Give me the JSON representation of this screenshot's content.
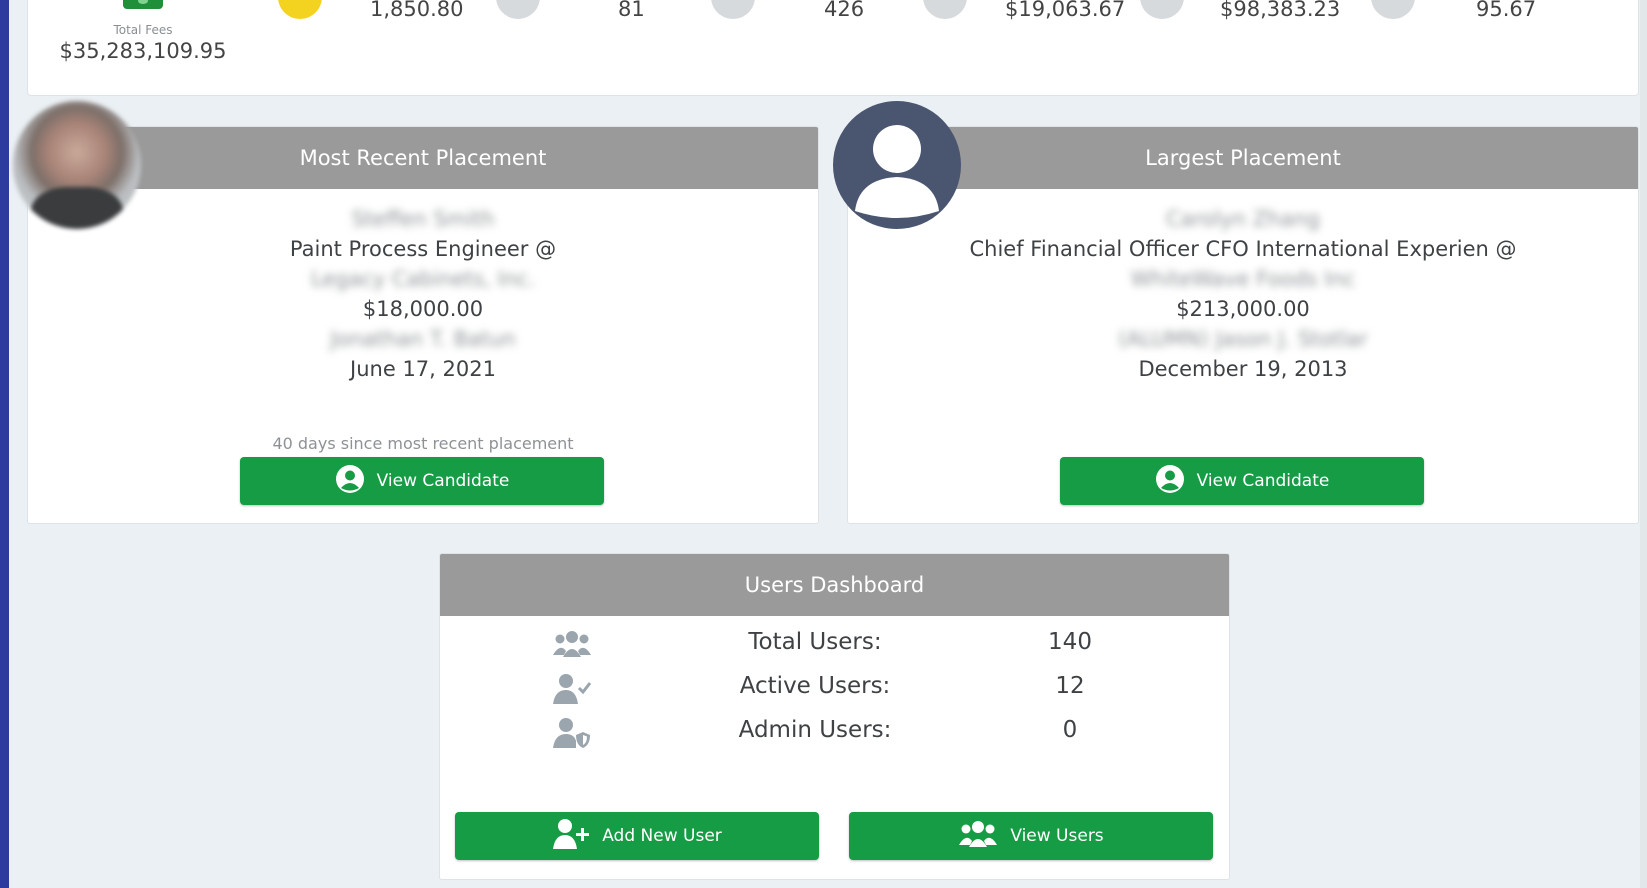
{
  "stats": {
    "total_fees_label": "Total Fees",
    "total_fees_value": "$35,283,109.95",
    "values": [
      "1,850.80",
      "81",
      "426",
      "$19,063.67",
      "$98,383.23",
      "95.67"
    ]
  },
  "recent": {
    "title": "Most Recent Placement",
    "candidate_name": "Steffen Smith",
    "job_title": "Paint Process Engineer @",
    "company": "Legacy Cabinets, Inc.",
    "amount": "$18,000.00",
    "recruiter": "Jonathan T. Batun",
    "date": "June 17, 2021",
    "since_text": "40 days since most recent placement",
    "button_label": "View Candidate"
  },
  "largest": {
    "title": "Largest Placement",
    "candidate_name": "Carolyn Zhang",
    "job_title": "Chief Financial Officer CFO International Experien @",
    "company": "WhiteWave Foods Inc",
    "amount": "$213,000.00",
    "recruiter": "(ALUMN) Jason J. Stotlar",
    "date": "December 19, 2013",
    "button_label": "View Candidate"
  },
  "users": {
    "title": "Users Dashboard",
    "rows": [
      {
        "label": "Total Users:",
        "value": "140",
        "icon": "users-group-icon"
      },
      {
        "label": "Active Users:",
        "value": "12",
        "icon": "user-check-icon"
      },
      {
        "label": "Admin Users:",
        "value": "0",
        "icon": "user-shield-icon"
      }
    ],
    "add_button_label": "Add New User",
    "view_button_label": "View Users"
  },
  "colors": {
    "header_gray": "#9a9a9a",
    "button_green": "#169c45",
    "sidebar_blue": "#2d3a9e",
    "background": "#eaf0f3"
  }
}
